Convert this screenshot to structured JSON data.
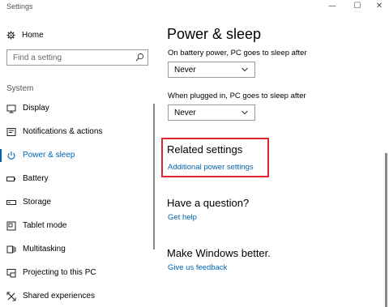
{
  "window": {
    "title": "Settings",
    "minimize": "—",
    "maximize": "☐",
    "close": "✕"
  },
  "sidebar": {
    "home_label": "Home",
    "search_placeholder": "Find a setting",
    "section_label": "System",
    "items": [
      {
        "label": "Display",
        "icon": "display-icon"
      },
      {
        "label": "Notifications & actions",
        "icon": "notifications-icon"
      },
      {
        "label": "Power & sleep",
        "icon": "power-icon",
        "active": true
      },
      {
        "label": "Battery",
        "icon": "battery-icon"
      },
      {
        "label": "Storage",
        "icon": "storage-icon"
      },
      {
        "label": "Tablet mode",
        "icon": "tablet-mode-icon"
      },
      {
        "label": "Multitasking",
        "icon": "multitasking-icon"
      },
      {
        "label": "Projecting to this PC",
        "icon": "projecting-icon"
      },
      {
        "label": "Shared experiences",
        "icon": "shared-experiences-icon"
      }
    ]
  },
  "main": {
    "title": "Power & sleep",
    "battery_label": "On battery power, PC goes to sleep after",
    "battery_value": "Never",
    "plugged_label": "When plugged in, PC goes to sleep after",
    "plugged_value": "Never",
    "related_heading": "Related settings",
    "related_link": "Additional power settings",
    "question_heading": "Have a question?",
    "question_link": "Get help",
    "feedback_heading": "Make Windows better.",
    "feedback_link": "Give us feedback"
  },
  "colors": {
    "accent": "#0063b1",
    "highlight_border": "#e0242e"
  }
}
